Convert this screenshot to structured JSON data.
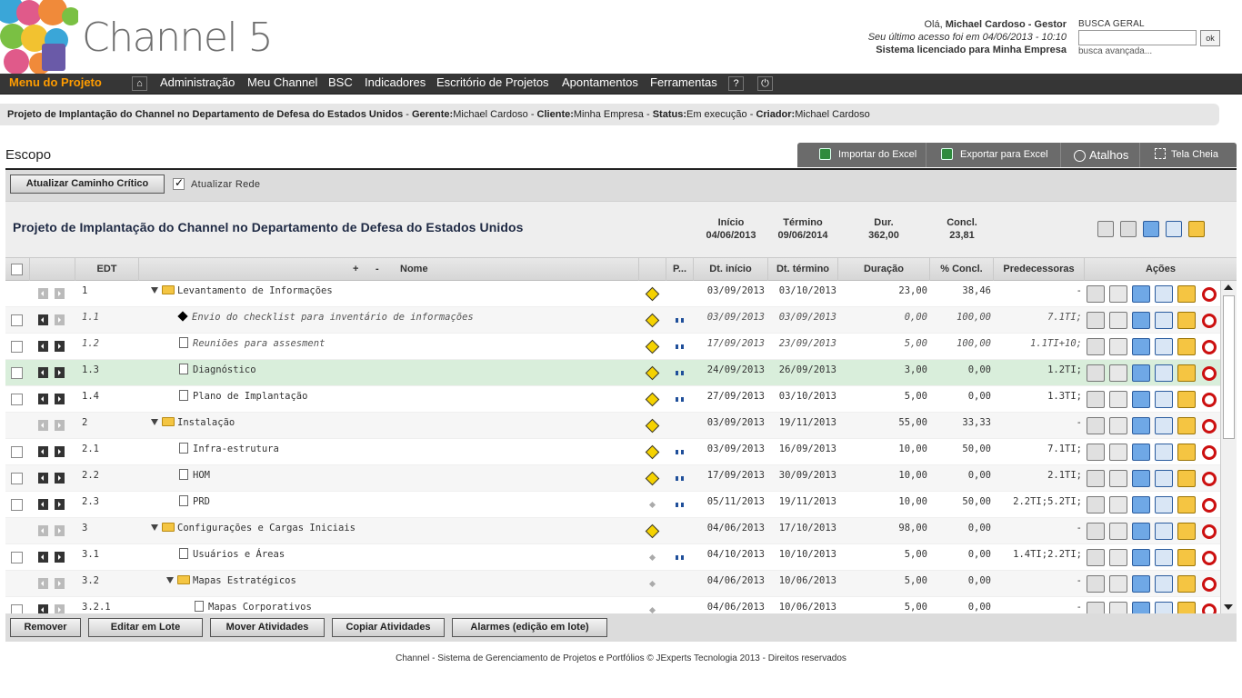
{
  "header": {
    "brand": "Channel 5",
    "greeting_prefix": "Olá, ",
    "user": "Michael Cardoso - Gestor",
    "last_access": "Seu último acesso foi em 04/06/2013 - 10:10",
    "license": "Sistema licenciado para Minha Empresa",
    "search_label": "BUSCA GERAL",
    "search_value": "",
    "ok_label": "ok",
    "advanced": "busca avançada..."
  },
  "menu": {
    "project_menu": "Menu do Projeto",
    "items": [
      "Administração",
      "Meu Channel",
      "BSC",
      "Indicadores",
      "Escritório de Projetos",
      "Apontamentos",
      "Ferramentas"
    ],
    "help": "?",
    "icons": [
      "home-icon",
      "power-icon"
    ]
  },
  "project_info": {
    "name": "Projeto de Implantação do Channel no Departamento de Defesa do Estados Unidos",
    "manager_label": "Gerente:",
    "manager": "Michael Cardoso",
    "client_label": "Cliente:",
    "client": "Minha Empresa",
    "status_label": "Status:",
    "status": "Em execução",
    "creator_label": "Criador:",
    "creator": "Michael Cardoso",
    "sep": " - "
  },
  "section_title": "Escopo",
  "toolbar": {
    "import": "Importar do Excel",
    "export": "Exportar para Excel",
    "shortcuts": "Atalhos",
    "fullscreen": "Tela Cheia"
  },
  "controls": {
    "critical_path": "Atualizar Caminho Crítico",
    "update_network": "Atualizar Rede"
  },
  "summary": {
    "title": "Projeto de Implantação do Channel no Departamento de Defesa do Estados Unidos",
    "start_label": "Início",
    "start": "04/06/2013",
    "end_label": "Término",
    "end": "09/06/2014",
    "dur_label": "Dur.",
    "dur": "362,00",
    "concl_label": "Concl.",
    "concl": "23,81"
  },
  "columns": {
    "edt": "EDT",
    "plus": "+",
    "minus": "-",
    "name": "Nome",
    "p": "P...",
    "start": "Dt. início",
    "end": "Dt. término",
    "duration": "Duração",
    "pct": "% Concl.",
    "pred": "Predecessoras",
    "actions": "Ações"
  },
  "rows": [
    {
      "edt": "1",
      "name": "Levantamento de Informações",
      "type": "folder",
      "level": 0,
      "start": "03/09/2013",
      "end": "03/10/2013",
      "dur": "23,00",
      "pct": "38,46",
      "pred": "-",
      "warn": "big",
      "link": false,
      "check": false,
      "italic": false
    },
    {
      "edt": "1.1",
      "name": "Envio do checklist para inventário de informações",
      "type": "milestone",
      "level": 1,
      "start": "03/09/2013",
      "end": "03/09/2013",
      "dur": "0,00",
      "pct": "100,00",
      "pred": "7.1TI;",
      "warn": "big",
      "link": true,
      "check": true,
      "italic": true
    },
    {
      "edt": "1.2",
      "name": "Reuniões para assesment",
      "type": "doc",
      "level": 1,
      "start": "17/09/2013",
      "end": "23/09/2013",
      "dur": "5,00",
      "pct": "100,00",
      "pred": "1.1TI+10;",
      "warn": "big",
      "link": true,
      "check": true,
      "italic": true
    },
    {
      "edt": "1.3",
      "name": "Diagnóstico",
      "type": "doc",
      "level": 1,
      "start": "24/09/2013",
      "end": "26/09/2013",
      "dur": "3,00",
      "pct": "0,00",
      "pred": "1.2TI;",
      "warn": "big",
      "link": true,
      "check": true,
      "italic": false
    },
    {
      "edt": "1.4",
      "name": "Plano de Implantação",
      "type": "doc",
      "level": 1,
      "start": "27/09/2013",
      "end": "03/10/2013",
      "dur": "5,00",
      "pct": "0,00",
      "pred": "1.3TI;",
      "warn": "big",
      "link": true,
      "check": true,
      "italic": false
    },
    {
      "edt": "2",
      "name": "Instalação",
      "type": "folder",
      "level": 0,
      "start": "03/09/2013",
      "end": "19/11/2013",
      "dur": "55,00",
      "pct": "33,33",
      "pred": "-",
      "warn": "big",
      "link": false,
      "check": false,
      "italic": false
    },
    {
      "edt": "2.1",
      "name": "Infra-estrutura",
      "type": "doc",
      "level": 1,
      "start": "03/09/2013",
      "end": "16/09/2013",
      "dur": "10,00",
      "pct": "50,00",
      "pred": "7.1TI;",
      "warn": "big",
      "link": true,
      "check": true,
      "italic": false
    },
    {
      "edt": "2.2",
      "name": "HOM",
      "type": "doc",
      "level": 1,
      "start": "17/09/2013",
      "end": "30/09/2013",
      "dur": "10,00",
      "pct": "0,00",
      "pred": "2.1TI;",
      "warn": "big",
      "link": true,
      "check": true,
      "italic": false
    },
    {
      "edt": "2.3",
      "name": "PRD",
      "type": "doc",
      "level": 1,
      "start": "05/11/2013",
      "end": "19/11/2013",
      "dur": "10,00",
      "pct": "50,00",
      "pred": "2.2TI;5.2TI;",
      "warn": "small",
      "link": true,
      "check": true,
      "italic": false
    },
    {
      "edt": "3",
      "name": "Configurações e Cargas Iniciais",
      "type": "folder",
      "level": 0,
      "start": "04/06/2013",
      "end": "17/10/2013",
      "dur": "98,00",
      "pct": "0,00",
      "pred": "-",
      "warn": "big",
      "link": false,
      "check": false,
      "italic": false
    },
    {
      "edt": "3.1",
      "name": "Usuários e Áreas",
      "type": "doc",
      "level": 1,
      "start": "04/10/2013",
      "end": "10/10/2013",
      "dur": "5,00",
      "pct": "0,00",
      "pred": "1.4TI;2.2TI;",
      "warn": "small",
      "link": true,
      "check": true,
      "italic": false
    },
    {
      "edt": "3.2",
      "name": "Mapas Estratégicos",
      "type": "folder",
      "level": 1,
      "start": "04/06/2013",
      "end": "10/06/2013",
      "dur": "5,00",
      "pct": "0,00",
      "pred": "-",
      "warn": "small",
      "link": false,
      "check": false,
      "italic": false
    },
    {
      "edt": "3.2.1",
      "name": "Mapas Corporativos",
      "type": "doc",
      "level": 2,
      "start": "04/06/2013",
      "end": "10/06/2013",
      "dur": "5,00",
      "pct": "0,00",
      "pred": "-",
      "warn": "small",
      "link": false,
      "check": true,
      "italic": false
    }
  ],
  "bottom_buttons": [
    "Remover",
    "Editar em Lote",
    "Mover Atividades",
    "Copiar Atividades",
    "Alarmes (edição em lote)"
  ],
  "footer": "Channel - Sistema de Gerenciamento de Projetos e Portfólios © JExperts Tecnologia 2013 - Direitos reservados",
  "colors": {
    "menu_bg": "#363636",
    "accent": "#ff9c00",
    "selected_row": "#d9eedb"
  }
}
